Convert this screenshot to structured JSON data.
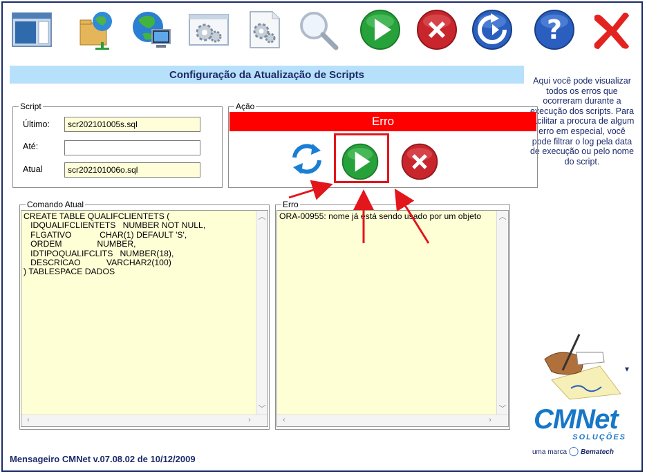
{
  "toolbar": {
    "icons": [
      "window-layout-icon",
      "network-folder-icon",
      "globe-computer-icon",
      "gear-window-icon",
      "gear-document-icon",
      "search-icon",
      "play-icon",
      "cancel-icon",
      "refresh-icon",
      "help-icon",
      "close-icon"
    ]
  },
  "title": "Configuração da Atualização de Scripts",
  "help_text": "Aqui você pode visualizar todos os erros que ocorreram durante a execução dos scripts. Para facilitar a procura de algum erro em especial, você pode filtrar o log pela data de execução ou pelo nome do script.",
  "script_group": {
    "legend": "Script",
    "ultimo_label": "Último:",
    "ultimo_value": "scr202101005s.sql",
    "ate_label": "Até:",
    "ate_value": "",
    "atual_label": "Atual",
    "atual_value": "scr202101006o.sql"
  },
  "acao_group": {
    "legend": "Ação",
    "status": "Erro",
    "status_color": "#ff0000",
    "highlight_color": "#e3161b"
  },
  "comando": {
    "legend": "Comando Atual",
    "text": "CREATE TABLE QUALIFCLIENTETS (\n   IDQUALIFCLIENTETS   NUMBER NOT NULL,\n   FLGATIVO            CHAR(1) DEFAULT 'S',\n   ORDEM               NUMBER,\n   IDTIPOQUALIFCLITS   NUMBER(18),\n   DESCRICAO           VARCHAR2(100)\n) TABLESPACE DADOS"
  },
  "erro": {
    "legend": "Erro",
    "text": "ORA-00955: nome já está sendo usado por um objeto"
  },
  "footer": "Mensageiro CMNet v.07.08.02 de 10/12/2009",
  "brand": {
    "name": "CMNet",
    "sub": "SOLUÇÕES",
    "tag_prefix": "uma marca",
    "tag_brand": "Bematech",
    "color": "#1777c8"
  }
}
